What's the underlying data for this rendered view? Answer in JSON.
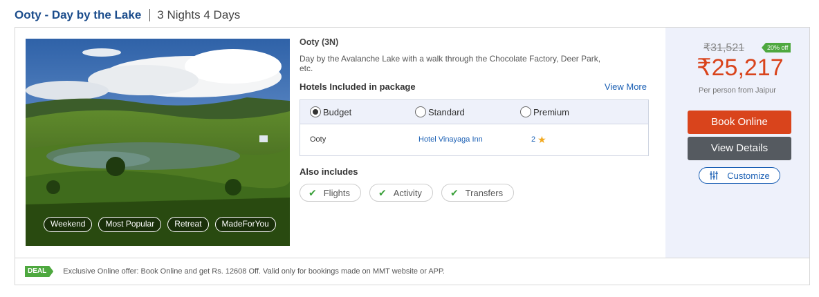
{
  "package": {
    "title": "Ooty - Day by the Lake",
    "duration": "3 Nights 4 Days"
  },
  "photo": {
    "tags": [
      "Weekend",
      "Most Popular",
      "Retreat",
      "MadeForYou"
    ]
  },
  "details": {
    "destination": "Ooty (3N)",
    "description": "Day by the Avalanche Lake with a walk through the Chocolate Factory, Deer Park, etc.",
    "hotels_title": "Hotels Included in package",
    "view_more": "View More",
    "hotel_options": [
      {
        "label": "Budget",
        "selected": true
      },
      {
        "label": "Standard",
        "selected": false
      },
      {
        "label": "Premium",
        "selected": false
      }
    ],
    "hotel": {
      "city": "Ooty",
      "name": "Hotel Vinayaga Inn",
      "rating": "2"
    },
    "also_includes_title": "Also includes",
    "includes": [
      "Flights",
      "Activity",
      "Transfers"
    ]
  },
  "pricing": {
    "old_price": "₹31,521",
    "discount": "20% off",
    "price": "₹25,217",
    "per_person": "Per person from Jaipur",
    "book_label": "Book Online",
    "view_label": "View Details",
    "customize_label": "Customize"
  },
  "deal": {
    "badge": "DEAL",
    "text": "Exclusive Online offer: Book Online and get Rs. 12608 Off. Valid only for bookings made on MMT website or APP."
  },
  "colors": {
    "title_blue": "#1c4d8c",
    "link_blue": "#1a5fb4",
    "price_red": "#d9441c",
    "green": "#4ea83f",
    "panel_bg": "#eef1fb"
  },
  "icons": [
    "check-icon",
    "star-icon",
    "sliders-icon"
  ]
}
